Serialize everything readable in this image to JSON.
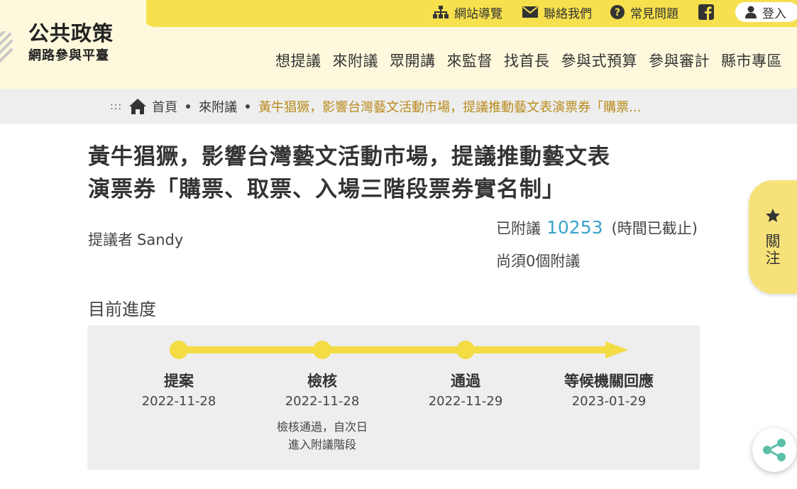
{
  "logo": {
    "line1": "公共政策",
    "line2": "網路參與平臺"
  },
  "topbar": {
    "sitemap": "網站導覽",
    "contact": "聯絡我們",
    "faq": "常見問題",
    "login": "登入"
  },
  "mainnav": [
    "想提議",
    "來附議",
    "眾開講",
    "來監督",
    "找首長",
    "參與式預算",
    "參與審計",
    "縣市專區"
  ],
  "breadcrumb": {
    "access_key": ":::",
    "home": "首頁",
    "parent": "來附議",
    "current": "黃牛猖獗，影響台灣藝文活動市場，提議推動藝文表演票券「購票..."
  },
  "proposal": {
    "title_line1": "黃牛猖獗，影響台灣藝文活動市場，提議推動藝文表",
    "title_line2": "演票券「購票、取票、入場三階段票券實名制」",
    "proposer_label": "提議者",
    "proposer_name": "Sandy",
    "seconded_label": "已附議",
    "seconded_count": "10253",
    "deadline_status": "(時間已截止)",
    "remaining": "尚須0個附議"
  },
  "progress": {
    "title": "目前進度",
    "steps": [
      {
        "label": "提案",
        "date": "2022-11-28",
        "note1": "",
        "note2": ""
      },
      {
        "label": "檢核",
        "date": "2022-11-28",
        "note1": "檢核通過，自次日",
        "note2": "進入附議階段"
      },
      {
        "label": "通過",
        "date": "2022-11-29",
        "note1": "",
        "note2": ""
      },
      {
        "label": "等候機關回應",
        "date": "2023-01-29",
        "note1": "",
        "note2": ""
      }
    ]
  },
  "side": {
    "follow_line1": "關",
    "follow_line2": "注"
  },
  "colors": {
    "brand_yellow": "#f6e04d",
    "header_bg": "#fef9dd",
    "count_blue": "#3aa3c9",
    "share_green": "#5cc0a8"
  },
  "icons": [
    "sitemap-icon",
    "mail-icon",
    "question-icon",
    "facebook-icon",
    "user-icon",
    "home-icon",
    "star-icon",
    "share-icon"
  ]
}
